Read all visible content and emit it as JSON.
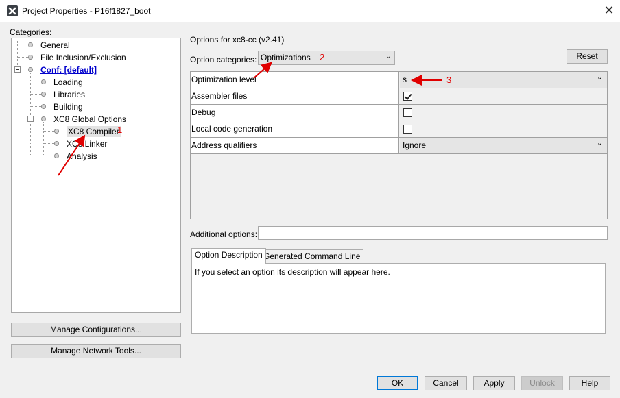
{
  "window": {
    "title": "Project Properties - P16f1827_boot"
  },
  "categories": {
    "label": "Categories:",
    "items": [
      {
        "label": "General"
      },
      {
        "label": "File Inclusion/Exclusion"
      },
      {
        "label": "Conf: [default]"
      },
      {
        "label": "Loading"
      },
      {
        "label": "Libraries"
      },
      {
        "label": "Building"
      },
      {
        "label": "XC8 Global Options"
      },
      {
        "label": "XC8 Compiler"
      },
      {
        "label": "XC8 Linker"
      },
      {
        "label": "Analysis"
      }
    ]
  },
  "left_buttons": {
    "manage_configs": "Manage Configurations...",
    "manage_tools": "Manage Network Tools..."
  },
  "options": {
    "header": "Options for xc8-cc (v2.41)",
    "category_label": "Option categories:",
    "category_value": "Optimizations",
    "reset_label": "Reset",
    "rows": [
      {
        "name": "Optimization level",
        "kind": "select",
        "value": "s"
      },
      {
        "name": "Assembler files",
        "kind": "checkbox",
        "checked": true
      },
      {
        "name": "Debug",
        "kind": "checkbox",
        "checked": false
      },
      {
        "name": "Local code generation",
        "kind": "checkbox",
        "checked": false
      },
      {
        "name": "Address qualifiers",
        "kind": "select",
        "value": "Ignore"
      }
    ],
    "additional_label": "Additional options:",
    "additional_value": ""
  },
  "tabs": {
    "option_description": "Option Description",
    "generated_command": "Generated Command Line"
  },
  "description": "If you select an option its description will appear here.",
  "footer": {
    "ok": "OK",
    "cancel": "Cancel",
    "apply": "Apply",
    "unlock": "Unlock",
    "help": "Help"
  },
  "annotations": {
    "a1": "1",
    "a2": "2",
    "a3": "3",
    "color": "#e00000"
  },
  "icons": {
    "app": "mplab-x-icon",
    "close": "close-icon",
    "chevron": "chevron-down-icon"
  }
}
